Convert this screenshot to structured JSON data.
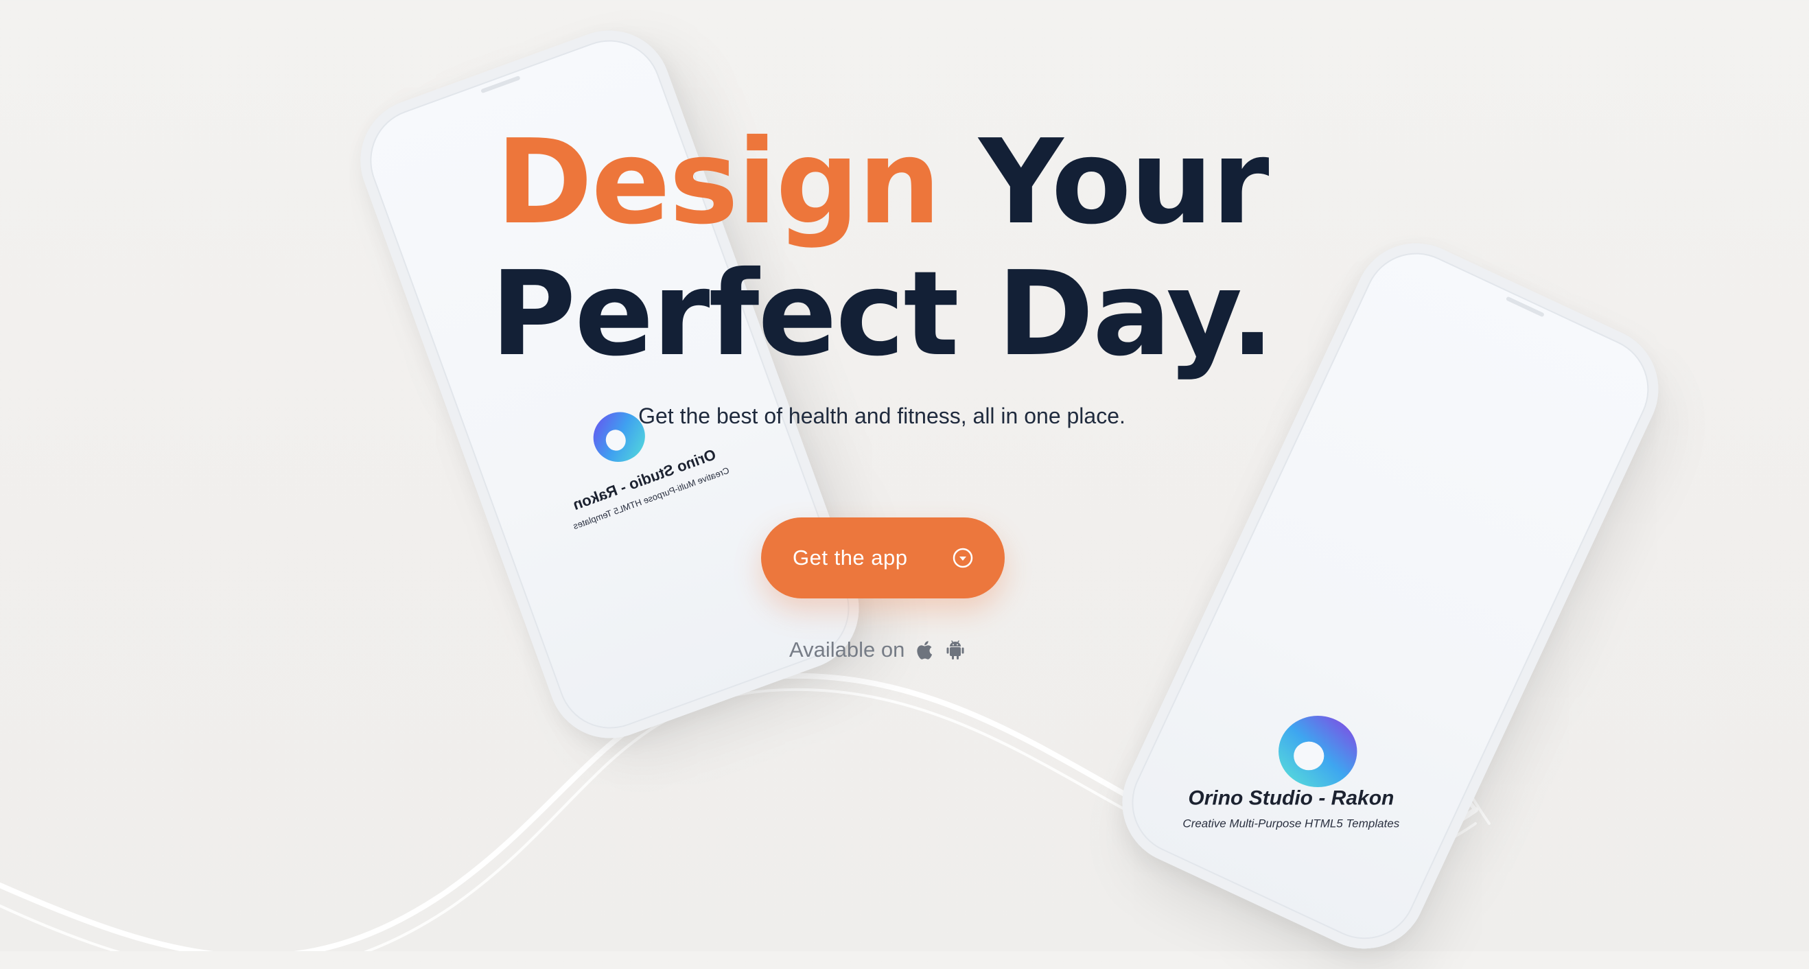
{
  "hero": {
    "headline_accent": "Design",
    "headline_line1_rest": "Your",
    "headline_line2": "Perfect Day.",
    "subheading": "Get the best of health and fitness, all in one place.",
    "cta_label": "Get the app",
    "cta_icon": "chevron-down-circle-icon",
    "available_label": "Available on",
    "platform_icons": [
      "apple-icon",
      "android-icon"
    ]
  },
  "phones": {
    "left": {
      "title": "Orino Studio - Rakon",
      "subtitle": "Creative Multi-Purpose HTML5 Templates",
      "logo_icon": "app-logo-icon",
      "mirrored": true
    },
    "right": {
      "title": "Orino Studio - Rakon",
      "subtitle": "Creative Multi-Purpose HTML5 Templates",
      "logo_icon": "app-logo-icon"
    }
  },
  "colors": {
    "accent": "#ed763b",
    "headline": "#132036",
    "background": "#f2f1ef",
    "muted_text": "#767c86"
  }
}
